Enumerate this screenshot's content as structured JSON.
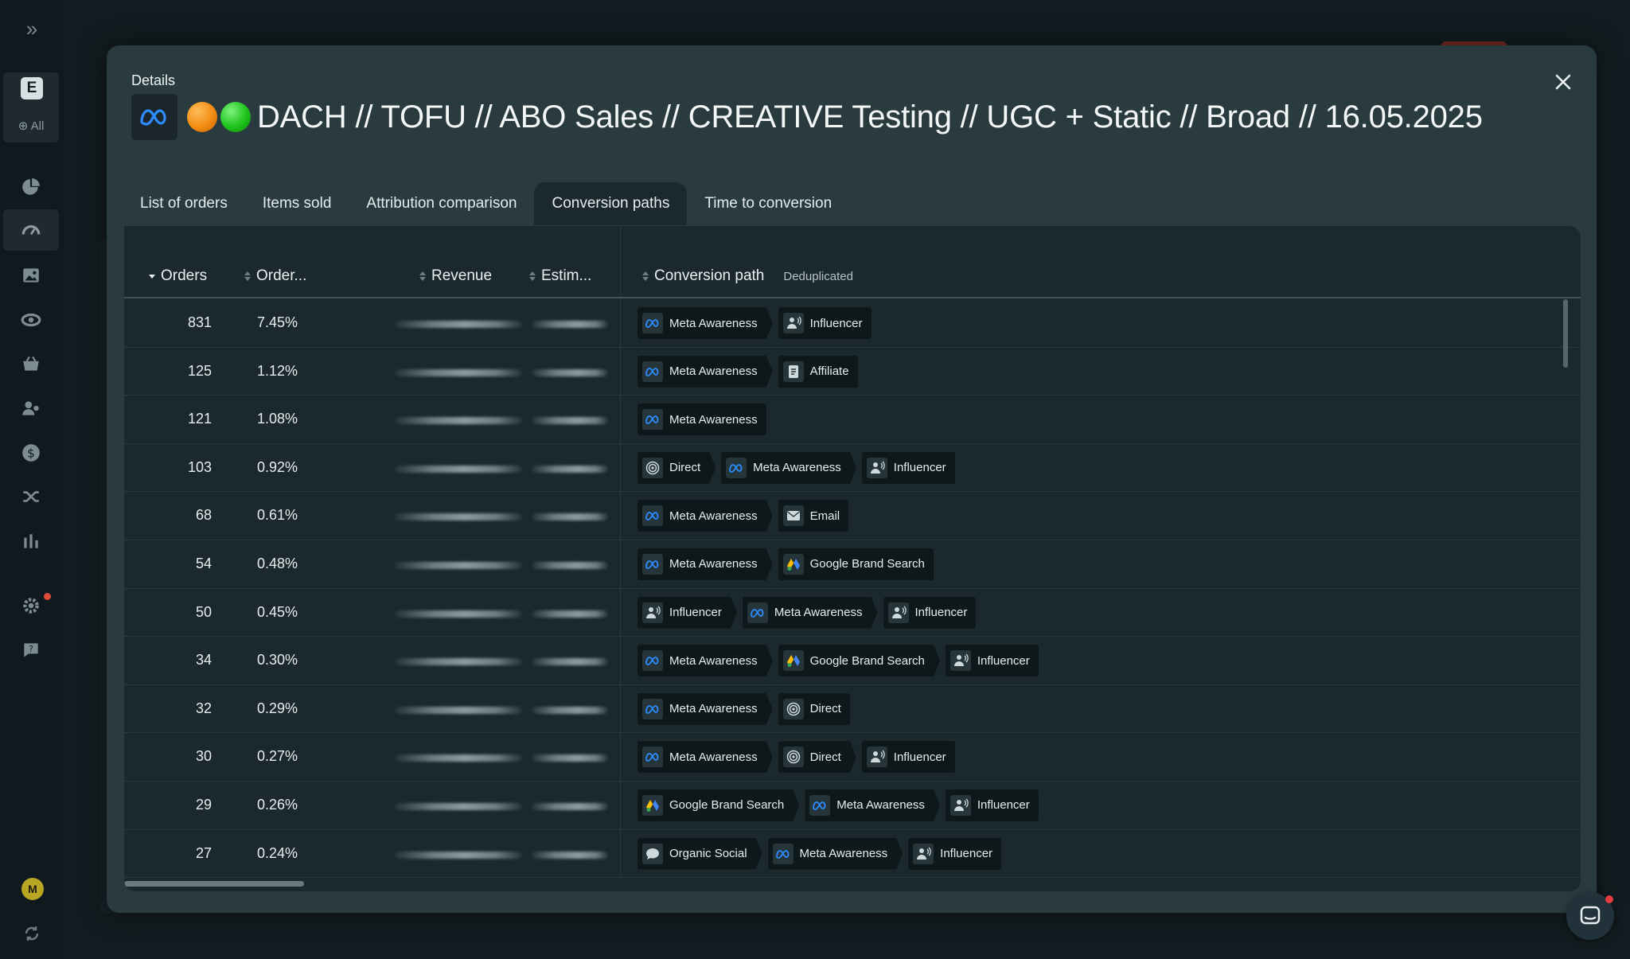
{
  "rail": {
    "workspace_letter": "E",
    "workspace_scope": "All",
    "avatar_initial": "M",
    "items": [
      "pie-chart-icon",
      "dashboard-gauge-icon",
      "image-icon",
      "orbit-icon",
      "basket-icon",
      "users-icon",
      "currency-icon",
      "shuffle-icon",
      "bar-chart-icon",
      "settings-icon",
      "help-icon"
    ]
  },
  "modal": {
    "kicker": "Details",
    "title": "DACH // TOFU // ABO Sales // CREATIVE Testing // UGC + Static // Broad // 16.05.2025",
    "status_dots": [
      "#f28c12",
      "#1fc21b"
    ]
  },
  "tabs": [
    {
      "label": "List of orders",
      "active": false
    },
    {
      "label": "Items sold",
      "active": false
    },
    {
      "label": "Attribution comparison",
      "active": false
    },
    {
      "label": "Conversion paths",
      "active": true
    },
    {
      "label": "Time to conversion",
      "active": false
    }
  ],
  "table": {
    "headers": {
      "orders": "Orders",
      "order_share": "Order...",
      "revenue": "Revenue",
      "estimated": "Estim...",
      "path": "Conversion path",
      "path_note": "Deduplicated"
    },
    "rows": [
      {
        "orders": "831",
        "pct": "7.45%",
        "path": [
          "Meta Awareness",
          "Influencer"
        ]
      },
      {
        "orders": "125",
        "pct": "1.12%",
        "path": [
          "Meta Awareness",
          "Affiliate"
        ]
      },
      {
        "orders": "121",
        "pct": "1.08%",
        "path": [
          "Meta Awareness"
        ]
      },
      {
        "orders": "103",
        "pct": "0.92%",
        "path": [
          "Direct",
          "Meta Awareness",
          "Influencer"
        ]
      },
      {
        "orders": "68",
        "pct": "0.61%",
        "path": [
          "Meta Awareness",
          "Email"
        ]
      },
      {
        "orders": "54",
        "pct": "0.48%",
        "path": [
          "Meta Awareness",
          "Google Brand Search"
        ]
      },
      {
        "orders": "50",
        "pct": "0.45%",
        "path": [
          "Influencer",
          "Meta Awareness",
          "Influencer"
        ]
      },
      {
        "orders": "34",
        "pct": "0.30%",
        "path": [
          "Meta Awareness",
          "Google Brand Search",
          "Influencer"
        ]
      },
      {
        "orders": "32",
        "pct": "0.29%",
        "path": [
          "Meta Awareness",
          "Direct"
        ]
      },
      {
        "orders": "30",
        "pct": "0.27%",
        "path": [
          "Meta Awareness",
          "Direct",
          "Influencer"
        ]
      },
      {
        "orders": "29",
        "pct": "0.26%",
        "path": [
          "Google Brand Search",
          "Meta Awareness",
          "Influencer"
        ]
      },
      {
        "orders": "27",
        "pct": "0.24%",
        "path": [
          "Organic Social",
          "Meta Awareness",
          "Influencer"
        ]
      }
    ]
  },
  "colors": {
    "accent_meta": "#1877f2",
    "notification": "#e04a3b"
  }
}
